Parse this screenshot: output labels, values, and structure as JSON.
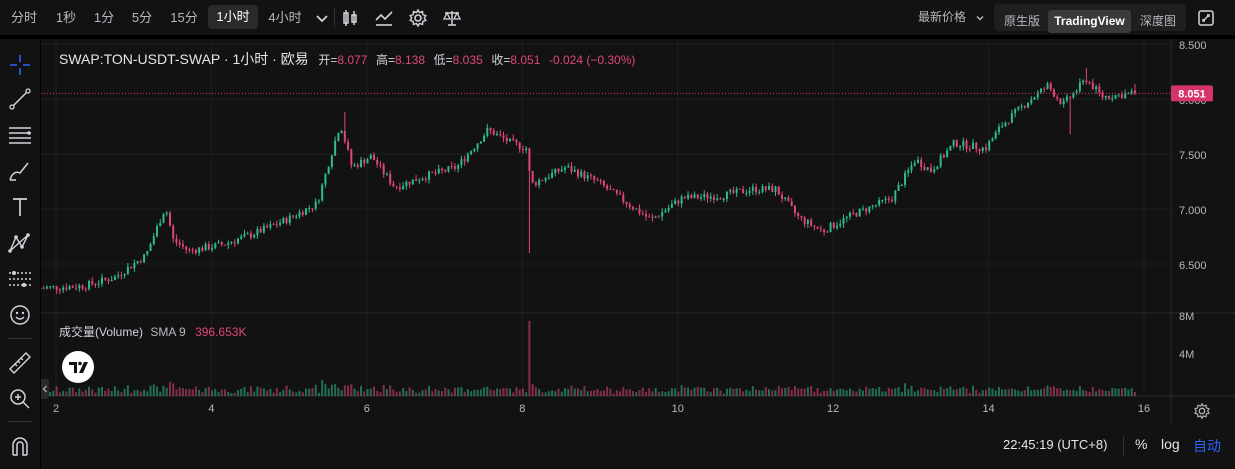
{
  "toolbar": {
    "intervals": [
      "分时",
      "1秒",
      "1分",
      "5分",
      "15分",
      "1小时",
      "4小时"
    ],
    "active_interval": "1小时",
    "price_type": "最新价格",
    "views": [
      "原生版",
      "TradingView",
      "深度图"
    ],
    "active_view": "TradingView"
  },
  "legend": {
    "symbol": "SWAP:TON-USDT-SWAP · 1小时 · 欧易",
    "open_label": "开=",
    "open": "8.077",
    "high_label": "高=",
    "high": "8.138",
    "low_label": "低=",
    "low": "8.035",
    "close_label": "收=",
    "close": "8.051",
    "change": "-0.024 (−0.30%)"
  },
  "volume_legend": {
    "name": "成交量(Volume)",
    "sma_label": "SMA 9",
    "sma_value": "396.653K"
  },
  "price_axis": {
    "ticks": [
      "8.500",
      "8.000",
      "7.500",
      "7.000",
      "6.500"
    ],
    "current_price": "8.051"
  },
  "volume_axis": {
    "ticks": [
      "8M",
      "4M"
    ]
  },
  "time_axis": {
    "ticks": [
      "2",
      "4",
      "6",
      "8",
      "10",
      "12",
      "14",
      "16"
    ]
  },
  "bottom": {
    "clock": "22:45:19 (UTC+8)",
    "percent": "%",
    "log": "log",
    "auto": "自动"
  },
  "colors": {
    "up": "#2ebd85",
    "down": "#e0457b",
    "accent": "#2962ff",
    "price_tag": "#d6336c"
  },
  "chart_data": {
    "type": "candlestick",
    "x_unit": "day",
    "x_range": [
      1.8,
      16.1
    ],
    "ylim": [
      6.15,
      8.55
    ],
    "close_anchors": [
      [
        1.8,
        6.28
      ],
      [
        2.4,
        6.3
      ],
      [
        2.8,
        6.38
      ],
      [
        3.2,
        6.58
      ],
      [
        3.45,
        7.02
      ],
      [
        3.55,
        6.72
      ],
      [
        3.75,
        6.62
      ],
      [
        4.2,
        6.68
      ],
      [
        4.6,
        6.78
      ],
      [
        5.0,
        6.9
      ],
      [
        5.4,
        7.05
      ],
      [
        5.7,
        7.78
      ],
      [
        5.85,
        7.38
      ],
      [
        6.1,
        7.48
      ],
      [
        6.4,
        7.2
      ],
      [
        6.8,
        7.3
      ],
      [
        7.2,
        7.38
      ],
      [
        7.6,
        7.72
      ],
      [
        7.9,
        7.6
      ],
      [
        8.1,
        7.55
      ],
      [
        8.15,
        7.22
      ],
      [
        8.6,
        7.38
      ],
      [
        9.0,
        7.25
      ],
      [
        9.4,
        7.05
      ],
      [
        9.7,
        6.9
      ],
      [
        10.1,
        7.1
      ],
      [
        10.6,
        7.12
      ],
      [
        11.0,
        7.18
      ],
      [
        11.3,
        7.18
      ],
      [
        11.6,
        6.92
      ],
      [
        11.9,
        6.8
      ],
      [
        12.3,
        6.95
      ],
      [
        12.8,
        7.1
      ],
      [
        13.1,
        7.45
      ],
      [
        13.3,
        7.35
      ],
      [
        13.6,
        7.6
      ],
      [
        14.0,
        7.55
      ],
      [
        14.2,
        7.75
      ],
      [
        14.5,
        7.95
      ],
      [
        14.8,
        8.12
      ],
      [
        15.0,
        7.95
      ],
      [
        15.3,
        8.18
      ],
      [
        15.5,
        8.02
      ],
      [
        15.9,
        8.05
      ]
    ],
    "extremes": [
      {
        "x": 5.7,
        "high": 7.88
      },
      {
        "x": 8.1,
        "low": 6.6
      },
      {
        "x": 15.25,
        "high": 8.28
      },
      {
        "x": 15.05,
        "low": 7.68
      }
    ],
    "last": {
      "open": 8.077,
      "high": 8.138,
      "low": 8.035,
      "close": 8.051
    },
    "volume_ylim": [
      0,
      8.2
    ],
    "volume_unit": "M",
    "volume_spike": {
      "x": 8.1,
      "value": 8.0
    }
  }
}
